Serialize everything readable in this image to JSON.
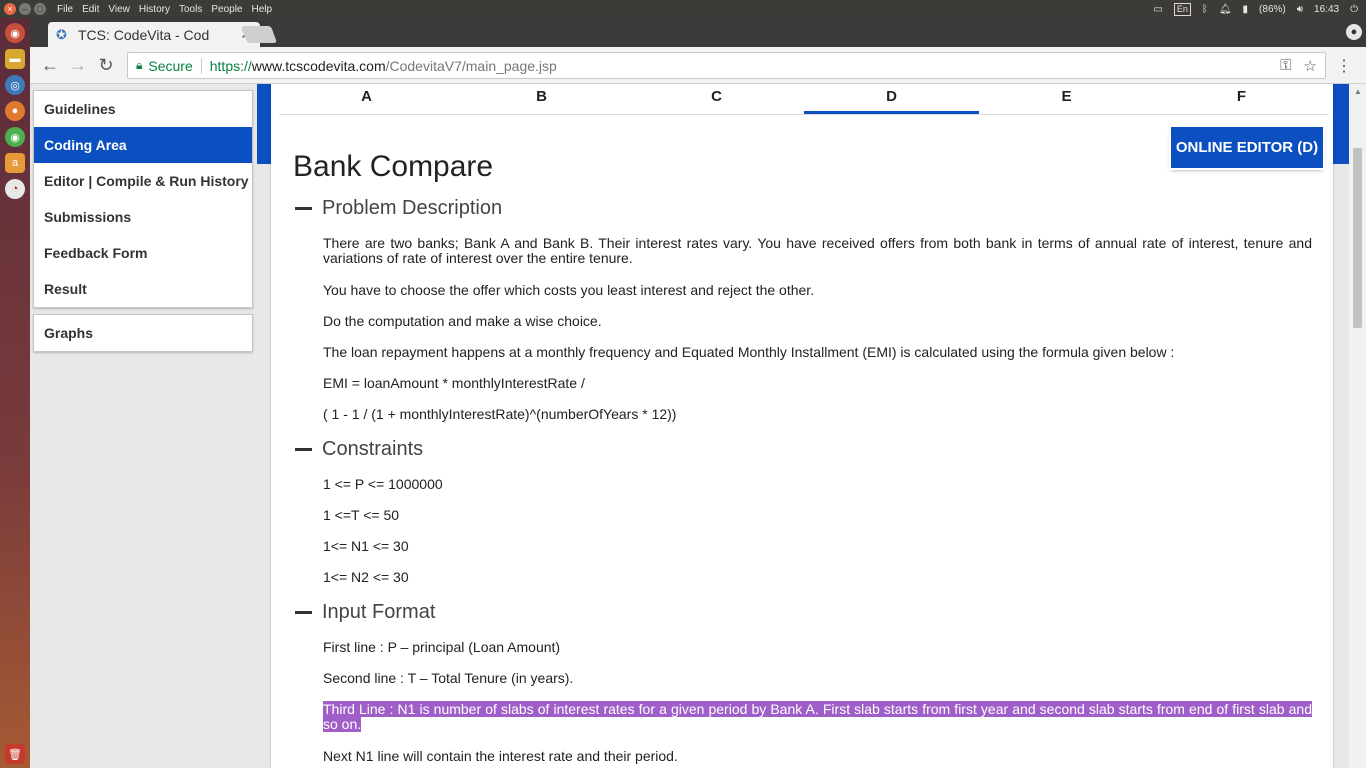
{
  "system": {
    "menu": [
      "File",
      "Edit",
      "View",
      "History",
      "Tools",
      "People",
      "Help"
    ],
    "keyboard": "En",
    "battery": "(86%)",
    "time": "16:43"
  },
  "browser": {
    "tab_title": "TCS: CodeVita - Cod",
    "close_glyph": "✕",
    "secure_label": "Secure",
    "url_scheme": "https://",
    "url_host": "www.tcscodevita.com",
    "url_path": "/CodevitaV7/main_page.jsp"
  },
  "sidebar": {
    "items": [
      "Guidelines",
      "Coding Area",
      "Editor | Compile & Run History",
      "Submissions",
      "Feedback Form",
      "Result"
    ],
    "active_index": 1,
    "secondary": [
      "Graphs"
    ]
  },
  "problem_tabs": {
    "labels": [
      "A",
      "B",
      "C",
      "D",
      "E",
      "F"
    ],
    "active": "D"
  },
  "editor_button": "ONLINE EDITOR (D)",
  "problem": {
    "title": "Bank Compare",
    "sections": {
      "description": {
        "heading": "Problem Description",
        "paragraphs": [
          "There are two banks; Bank A and Bank B. Their interest rates vary. You have received offers from both bank in terms of annual rate of interest, tenure and variations of rate of interest over the entire tenure.",
          "You have to choose the offer which costs you least interest and reject the other.",
          "Do the computation and make a wise choice.",
          "The loan repayment happens at a monthly frequency and Equated Monthly Installment (EMI) is calculated using the formula given below :",
          "EMI = loanAmount * monthlyInterestRate /",
          "( 1 - 1 / (1 + monthlyInterestRate)^(numberOfYears * 12))"
        ]
      },
      "constraints": {
        "heading": "Constraints",
        "paragraphs": [
          "1 <= P <= 1000000",
          "1 <=T <= 50",
          "1<= N1 <= 30",
          "1<= N2 <= 30"
        ]
      },
      "input_format": {
        "heading": "Input Format",
        "paragraphs": [
          "First line : P – principal (Loan Amount)",
          "Second line : T – Total Tenure (in years).",
          "Third Line : N1 is number of slabs of interest rates for a given period by Bank A. First slab starts from first year and second slab starts from end of first slab and so on.",
          "Next N1 line will contain the interest rate and their period."
        ]
      }
    }
  }
}
